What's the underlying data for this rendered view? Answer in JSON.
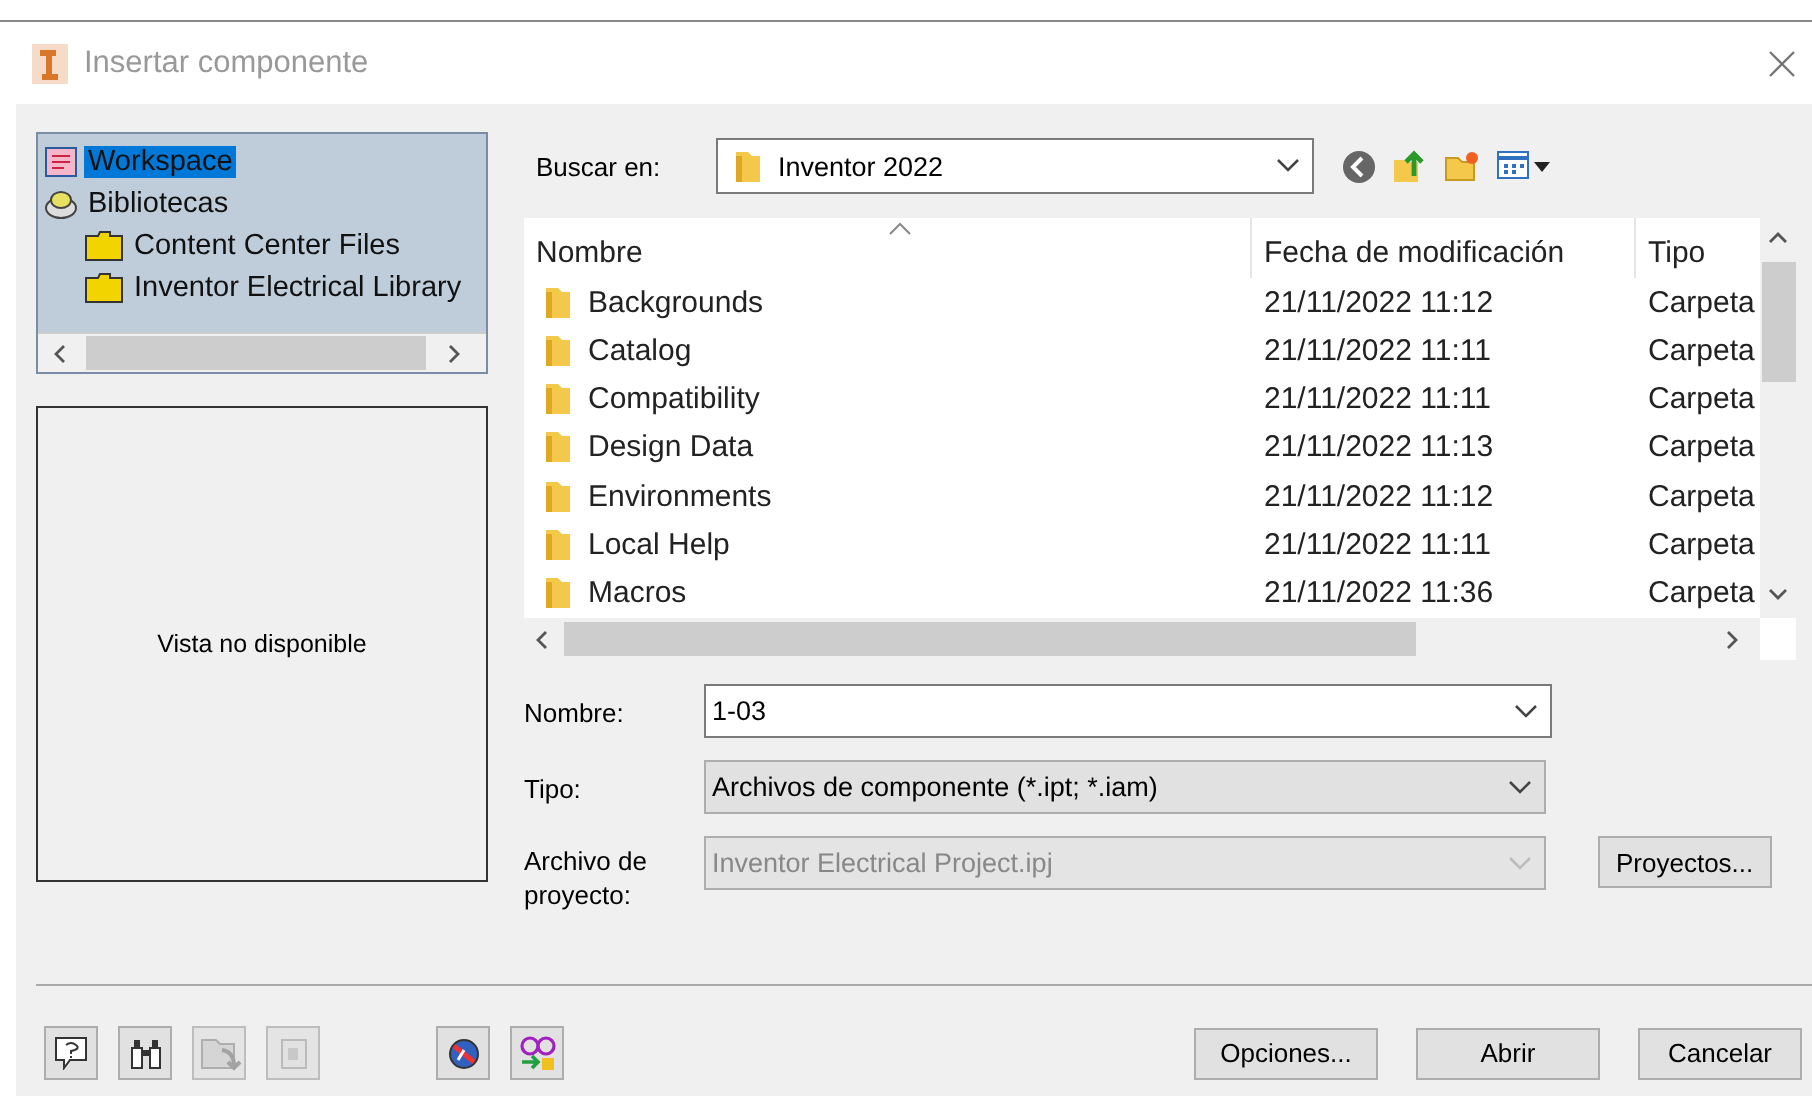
{
  "window": {
    "title": "Insertar componente"
  },
  "tree": {
    "items": [
      {
        "label": "Workspace",
        "kind": "workspace",
        "selected": true
      },
      {
        "label": "Bibliotecas",
        "kind": "library",
        "selected": false,
        "children": [
          {
            "label": "Content Center Files",
            "kind": "folder",
            "selected": false
          },
          {
            "label": "Inventor Electrical Library",
            "kind": "folder",
            "selected": false
          }
        ]
      }
    ]
  },
  "preview": {
    "message": "Vista no disponible"
  },
  "look_in": {
    "label": "Buscar en:",
    "value": "Inventor 2022"
  },
  "file_list": {
    "columns": [
      {
        "label": "Nombre",
        "sorted": true
      },
      {
        "label": "Fecha de modificación",
        "sorted": false
      },
      {
        "label": "Tipo",
        "sorted": false
      }
    ],
    "rows": [
      {
        "name": "Backgrounds",
        "date": "21/11/2022 11:12",
        "type": "Carpeta"
      },
      {
        "name": "Catalog",
        "date": "21/11/2022 11:11",
        "type": "Carpeta"
      },
      {
        "name": "Compatibility",
        "date": "21/11/2022 11:11",
        "type": "Carpeta"
      },
      {
        "name": "Design Data",
        "date": "21/11/2022 11:13",
        "type": "Carpeta"
      },
      {
        "name": "Environments",
        "date": "21/11/2022 11:12",
        "type": "Carpeta"
      },
      {
        "name": "Local Help",
        "date": "21/11/2022 11:11",
        "type": "Carpeta"
      },
      {
        "name": "Macros",
        "date": "21/11/2022 11:36",
        "type": "Carpeta"
      }
    ]
  },
  "fields": [
    {
      "label": "Nombre:",
      "value": "1-03",
      "kind": "combo",
      "disabled": false
    },
    {
      "label": "Tipo:",
      "value": "Archivos de componente (*.ipt; *.iam)",
      "kind": "select",
      "disabled": false
    },
    {
      "label": "Archivo de proyecto:",
      "value": "Inventor Electrical Project.ipj",
      "kind": "select",
      "disabled": true,
      "button": "Proyectos..."
    }
  ],
  "footer": {
    "tools": [
      {
        "kind": "help",
        "disabled": false
      },
      {
        "kind": "find",
        "disabled": false
      },
      {
        "kind": "import",
        "disabled": true
      },
      {
        "kind": "export",
        "disabled": true
      },
      {
        "kind": "web",
        "disabled": false
      },
      {
        "kind": "link",
        "disabled": false
      }
    ],
    "buttons": [
      "Opciones...",
      "Abrir",
      "Cancelar"
    ]
  }
}
